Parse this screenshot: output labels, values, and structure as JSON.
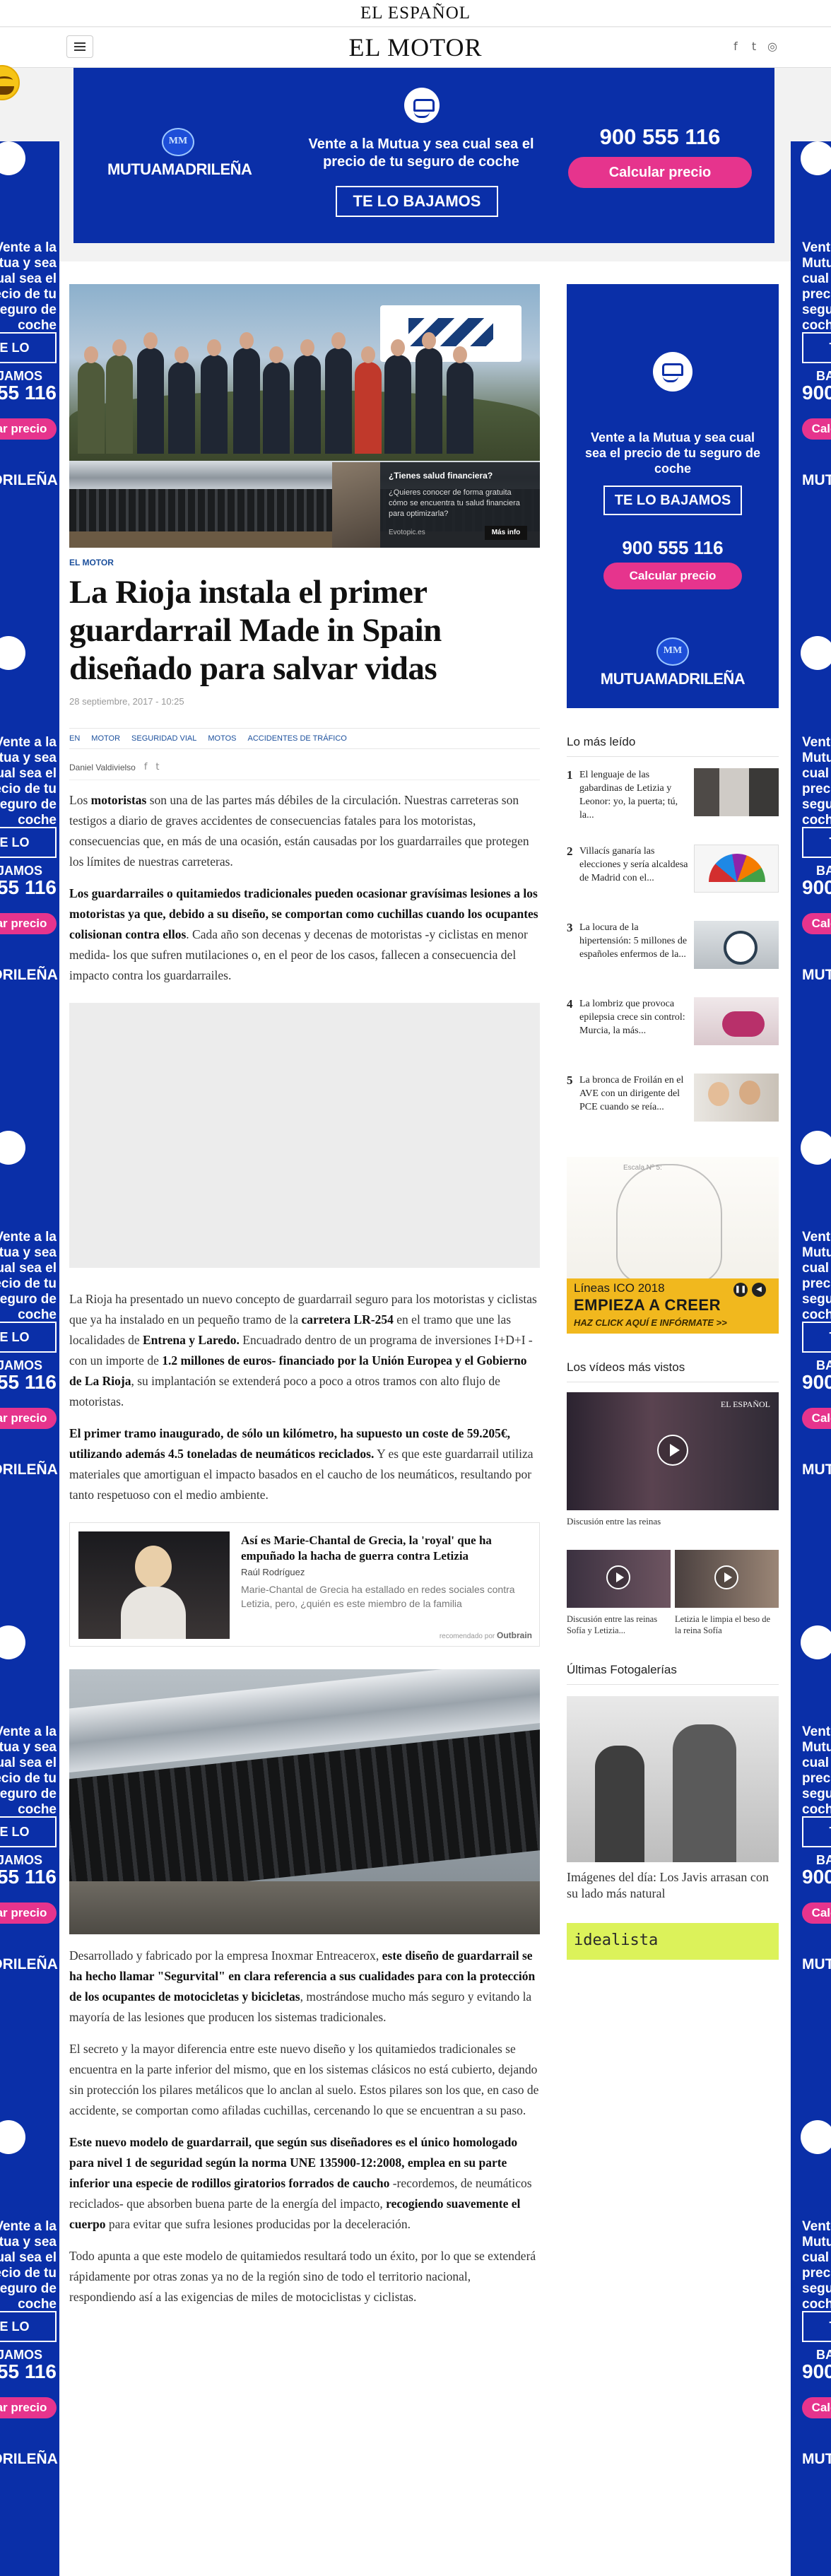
{
  "top_strip": {
    "brand": "EL ESPAÑOL"
  },
  "header": {
    "brand": "EL MOTOR",
    "social": [
      {
        "label": "f",
        "icon": "facebook-icon"
      },
      {
        "label": "t",
        "icon": "twitter-icon"
      },
      {
        "label": "◎",
        "icon": "instagram-icon"
      }
    ]
  },
  "ads": {
    "mutua": {
      "logo": "MUTUAMADRILEÑA",
      "message": "Vente a la Mutua y sea cual sea el precio de tu seguro de coche",
      "button": "TE LO BAJAMOS",
      "phone": "900 555 116",
      "cta": "Calcular precio"
    },
    "skin": {
      "text": "Vente a la Mutua y sea cual sea el precio de tu seguro de coche",
      "button": "TE LO BAJAMOS",
      "phone": "900 555 116",
      "cta": "Calcular precio",
      "logo": "MUTUAMADRILEÑA"
    },
    "ico": {
      "scale": "Escala Nº 5:",
      "small": "Líneas ICO 2018",
      "big": "EMPIEZA A CREER",
      "cta": "HAZ CLICK AQUÍ E INFÓRMATE >>"
    },
    "idealista": "idealista"
  },
  "article": {
    "promo": {
      "title": "¿Tienes salud financiera?",
      "body": "¿Quieres conocer de forma gratuita cómo se encuentra tu salud financiera para optimizarla?",
      "source": "Evotopic.es",
      "more": "Más info"
    },
    "section": "EL MOTOR",
    "headline": "La Rioja instala el primer guardarrail Made in Spain diseñado para salvar vidas",
    "date": "28 septiembre, 2017",
    "time": "10:25",
    "tags": [
      "EN",
      "MOTOR",
      "SEGURIDAD VIAL",
      "MOTOS",
      "ACCIDENTES DE TRÁFICO"
    ],
    "author": "Daniel Valdivielso",
    "p1": [
      {
        "t": "Los "
      },
      {
        "t": "motoristas",
        "b": true
      },
      {
        "t": " son una de las partes más débiles de la circulación. Nuestras carreteras son testigos a diario de graves accidentes de consecuencias fatales para los motoristas, consecuencias que, en más de una ocasión, están causadas por los guardarrailes que protegen los límites de nuestras carreteras."
      }
    ],
    "p2": [
      {
        "t": "Los guardarrailes o quitamiedos tradicionales pueden ocasionar gravísimas lesiones a los motoristas ya que, debido a su diseño, se comportan como cuchillas cuando los ocupantes colisionan contra ellos",
        "b": true
      },
      {
        "t": ". Cada año son decenas y decenas de motoristas -y ciclistas en menor medida- los que sufren mutilaciones o, en el peor de los casos, fallecen a consecuencia del impacto contra los guardarrailes."
      }
    ],
    "p3": [
      {
        "t": "La Rioja ha presentado un nuevo concepto de guardarrail seguro para los motoristas y ciclistas que ya ha instalado en un pequeño tramo de la "
      },
      {
        "t": "carretera LR-254",
        "b": true
      },
      {
        "t": " en el tramo que une las localidades de "
      },
      {
        "t": "Entrena y Laredo.",
        "b": true
      },
      {
        "t": " Encuadrado dentro de un programa de inversiones I+D+I -con un importe de "
      },
      {
        "t": "1.2 millones de euros- financiado por la Unión Europea y el Gobierno de La Rioja",
        "b": true
      },
      {
        "t": ", su implantación se extenderá poco a poco a otros tramos con alto flujo de motoristas."
      }
    ],
    "p4": [
      {
        "t": "El primer tramo inaugurado, de sólo un kilómetro, ha supuesto un coste de 59.205€, utilizando además 4.5 toneladas de neumáticos reciclados.",
        "b": true
      },
      {
        "t": " Y es que este guardarrail utiliza materiales que amortiguan el impacto basados en el caucho de los neumáticos, resultando por tanto respetuoso con el medio ambiente."
      }
    ],
    "outbrain": {
      "title": "Así es Marie-Chantal de Grecia, la 'royal' que ha empuñado la hacha de guerra contra Letizia",
      "author": "Raúl Rodríguez",
      "desc": "Marie-Chantal de Grecia ha estallado en redes sociales contra Letizia, pero, ¿quién es este miembro de la familia",
      "rec_prefix": "recomendado por",
      "rec_brand": "Outbrain"
    },
    "p5": [
      {
        "t": "Desarrollado y fabricado por la empresa Inoxmar Entreacerox, "
      },
      {
        "t": "este diseño de guardarrail se ha hecho llamar \"Segurvital\" en clara referencia a sus cualidades para con la protección de los ocupantes de motocicletas y bicicletas",
        "b": true
      },
      {
        "t": ", mostrándose mucho más seguro y evitando la mayoría de las lesiones que producen los sistemas tradicionales."
      }
    ],
    "p6": [
      {
        "t": "El secreto y la mayor diferencia entre este nuevo diseño y los quitamiedos tradicionales se encuentra en la parte inferior del mismo, que en los sistemas clásicos no está cubierto, dejando sin protección los pilares metálicos que lo anclan al suelo. Estos pilares son los que, en caso de accidente, se comportan como afiladas cuchillas, cercenando lo que se encuentran a su paso."
      }
    ],
    "p7": [
      {
        "t": "Este nuevo modelo de guardarrail, que según sus diseñadores es el único homologado para nivel 1 de seguridad según la norma UNE 135900-12:2008, emplea en su parte inferior una especie de rodillos giratorios forrados de caucho",
        "b": true
      },
      {
        "t": " -recordemos, de neumáticos reciclados- que absorben buena parte de la energía del impacto, "
      },
      {
        "t": "recogiendo suavemente el cuerpo",
        "b": true
      },
      {
        "t": " para evitar que sufra lesiones producidas por la deceleración."
      }
    ],
    "p8": [
      {
        "t": "Todo apunta a que este modelo de quitamiedos resultará todo un éxito, por lo que se extenderá rápidamente por otras zonas ya no de la región sino de todo el territorio nacional, respondiendo así a las exigencias de miles de motociclistas y ciclistas."
      }
    ]
  },
  "sidebar": {
    "most_read_title": "Lo más leído",
    "most_read": [
      {
        "num": "1",
        "title": "El lenguaje de las gabardinas de Letizia y Leonor: yo, la puerta; tú, la..."
      },
      {
        "num": "2",
        "title": "Villacís ganaría las elecciones y sería alcaldesa de Madrid con el..."
      },
      {
        "num": "3",
        "title": "La locura de la hipertensión: 5 millones de españoles enfermos de la..."
      },
      {
        "num": "4",
        "title": "La lombriz que provoca epilepsia crece sin control: Murcia, la más..."
      },
      {
        "num": "5",
        "title": "La bronca de Froilán en el AVE con un dirigente del PCE cuando se reía..."
      }
    ],
    "videos_title": "Los vídeos más vistos",
    "video_brand": "EL ESPAÑOL",
    "video_main_caption": "Discusión entre las reinas",
    "videos": [
      {
        "caption": "Discusión entre las reinas Sofía y Letizia..."
      },
      {
        "caption": "Letizia le limpia el beso de la reina Sofía"
      }
    ],
    "photos_title": "Últimas Fotogalerías",
    "photo_caption": "Imágenes del día: Los Javis arrasan con su lado más natural"
  }
}
